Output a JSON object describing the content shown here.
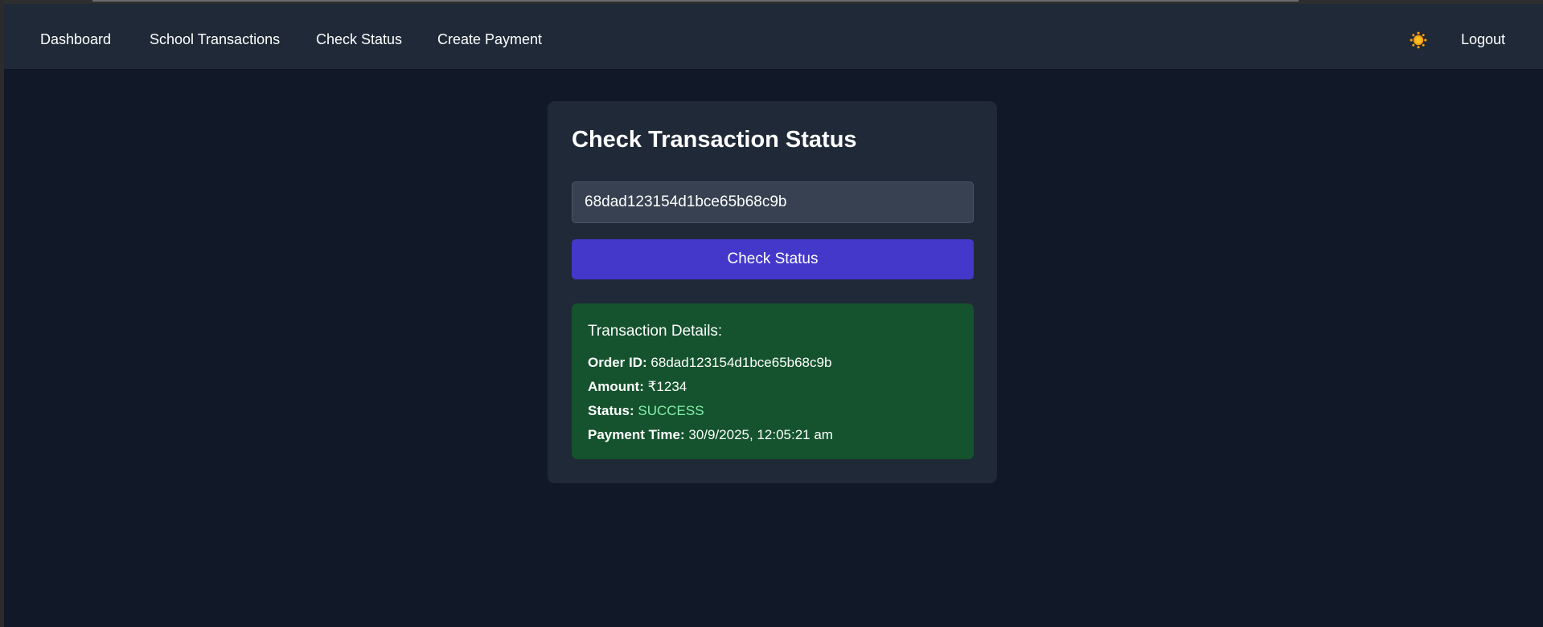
{
  "nav": {
    "links": [
      "Dashboard",
      "School Transactions",
      "Check Status",
      "Create Payment"
    ],
    "theme_icon": "sun-icon",
    "logout": "Logout"
  },
  "main": {
    "title": "Check Transaction Status",
    "order_input_value": "68dad123154d1bce65b68c9b",
    "check_button_label": "Check Status",
    "details": {
      "title": "Transaction Details:",
      "order_id_label": "Order ID:",
      "order_id": "68dad123154d1bce65b68c9b",
      "amount_label": "Amount:",
      "amount": "₹1234",
      "status_label": "Status:",
      "status": "SUCCESS",
      "payment_time_label": "Payment Time:",
      "payment_time": "30/9/2025, 12:05:21 am"
    }
  },
  "colors": {
    "background": "#111827",
    "navbar": "#1f2937",
    "card": "#1f2937",
    "input": "#374151",
    "accent": "#4338ca",
    "success_panel": "#14532d",
    "success_text": "#86efac"
  }
}
